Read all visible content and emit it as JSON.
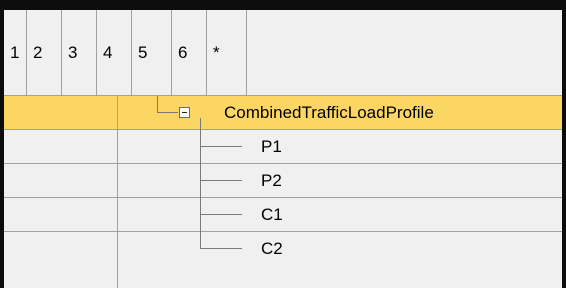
{
  "level_tabs": [
    "1",
    "2",
    "3",
    "4",
    "5",
    "6",
    "*"
  ],
  "tree": {
    "root": {
      "label": "CombinedTrafficLoadProfile",
      "expanded": true,
      "selected": true
    },
    "children": [
      {
        "label": "P1"
      },
      {
        "label": "P2"
      },
      {
        "label": "C1"
      },
      {
        "label": "C2"
      }
    ]
  },
  "colors": {
    "selected_row": "#fcd662",
    "background": "#f0f0f0",
    "grid_line": "#a0a0a0"
  }
}
